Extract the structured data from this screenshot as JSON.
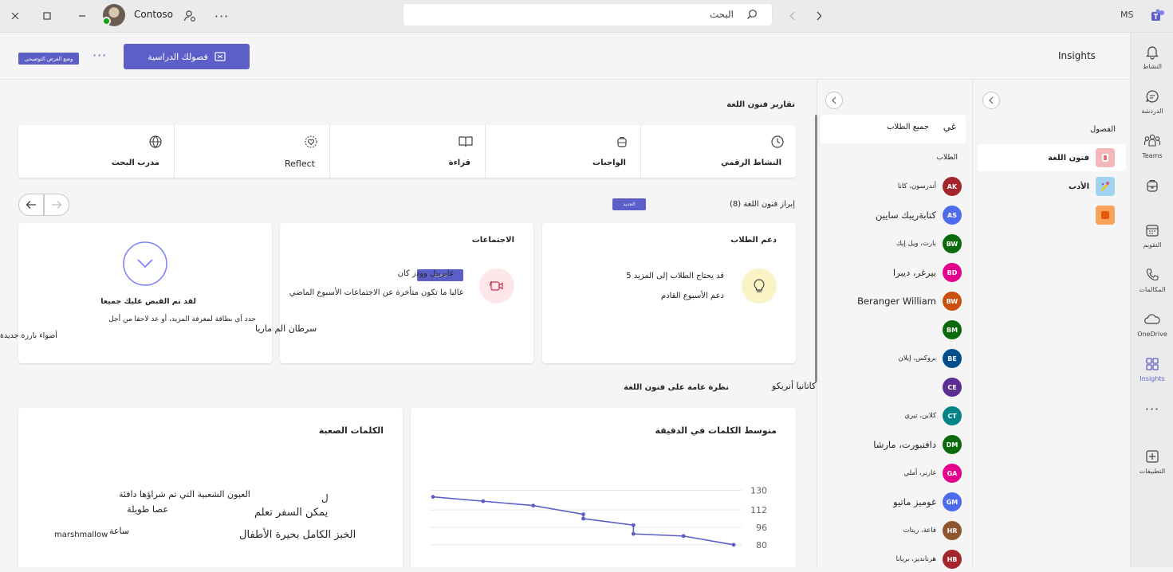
{
  "titlebar": {
    "org": "Contoso",
    "search_text": "البحث",
    "user_initials": "MS"
  },
  "rail": [
    {
      "label": "النشاط",
      "icon": "bell-icon"
    },
    {
      "label": "الدردشة",
      "icon": "chat-icon"
    },
    {
      "label": "Teams",
      "icon": "teams-icon"
    },
    {
      "label": "",
      "icon": "backpack-icon"
    },
    {
      "label": "التقويم",
      "icon": "calendar-icon"
    },
    {
      "label": "المكالمات",
      "icon": "phone-icon"
    },
    {
      "label": "OneDrive",
      "icon": "cloud-icon"
    },
    {
      "label": "Insights",
      "icon": "insights-icon"
    },
    {
      "label": "",
      "icon": "more-icon"
    },
    {
      "label": "التطبيقات",
      "icon": "add-apps-icon"
    }
  ],
  "topstrip": {
    "app_title": "Insights",
    "classes_button": "فصولك الدراسية",
    "present_mode": "وضع العرض التوضيحي"
  },
  "classes": {
    "heading": "الفصول",
    "items": [
      {
        "name": "فنون اللغة",
        "color": "#f4b8b8"
      },
      {
        "name": "الأدب",
        "color": "#9fd3f0"
      },
      {
        "name": "",
        "color": "#f7a35c"
      }
    ]
  },
  "students": {
    "all_label": "جميع الطلاب",
    "all_prefix": "غي",
    "heading": "الطلاب",
    "items": [
      {
        "initials": "AK",
        "name": "أندرسون، كانا",
        "color": "#a4262c",
        "big": false
      },
      {
        "initials": "AS",
        "name": "كتابةريبك سايين",
        "color": "#4f6bed",
        "big": true
      },
      {
        "initials": "BW",
        "name": "بارت، ويل إيك",
        "color": "#0b6a0b",
        "big": false
      },
      {
        "initials": "BD",
        "name": "بيرغر، ديبرا",
        "color": "#e3008c",
        "big": true
      },
      {
        "initials": "BW",
        "name": "Beranger William",
        "color": "#ca5010",
        "big": true
      },
      {
        "initials": "BM",
        "name": "",
        "color": "#0b6a0b",
        "big": false
      },
      {
        "initials": "BE",
        "name": "بروكس، إيلان",
        "color": "#004e8c",
        "big": false
      },
      {
        "initials": "CE",
        "name": "",
        "color": "#5c2e91",
        "big": false
      },
      {
        "initials": "CT",
        "name": "كلاين، تيري",
        "color": "#038387",
        "big": false
      },
      {
        "initials": "DM",
        "name": "دافنبورت، مارشا",
        "color": "#0b6a0b",
        "big": true
      },
      {
        "initials": "GA",
        "name": "غارنر، أملي",
        "color": "#e3008c",
        "big": false
      },
      {
        "initials": "GM",
        "name": "غوميز ماتيو",
        "color": "#4f6bed",
        "big": true
      },
      {
        "initials": "HR",
        "name": "قاعة، ريتات",
        "color": "#8e562e",
        "big": false
      },
      {
        "initials": "HB",
        "name": "هرنانديز، بريانا",
        "color": "#a4262c",
        "big": false
      }
    ]
  },
  "reports": {
    "title": "تقارير فنون اللغة",
    "tabs": [
      {
        "label": "النشاط الرقمي",
        "icon": "clock-icon"
      },
      {
        "label": "الواجبات",
        "icon": "assignment-icon"
      },
      {
        "label": "قراءة",
        "icon": "book-icon"
      },
      {
        "label": "Reflect",
        "icon": "reflect-icon"
      },
      {
        "label": "مدرب البحث",
        "icon": "globe-icon"
      }
    ]
  },
  "highlights": {
    "title": "إبراز فنون اللغة (8)",
    "new_badge": "الجديد",
    "card1": {
      "title": "دعم الطلاب",
      "line1": "5 قد يحتاج الطلاب إلى المزيد",
      "line2": "دعم الأسبوع القادم"
    },
    "card2": {
      "title": "الاجتماعات",
      "line1": "غابرييل وودز كان",
      "line2": "غالبا ما تكون متأخرة عن الاجتماعات الأسبوع الماضي",
      "badge": "تحديث"
    },
    "card3": {
      "line1": "لقد تم القبض عليك جميعا",
      "line2": "حدد أي بطاقة لمعرفة المزيد، أو عد لاحقا من أجل",
      "overflow1": "سرطان الم ماريا",
      "overflow2": "أضواء بارزة جديدة"
    }
  },
  "overview": {
    "title": "نظرة عامة على فنون اللغة",
    "overflow_name": "كاتانيا أنريكو"
  },
  "wpm": {
    "title": "متوسط الكلمات في الدقيقة"
  },
  "hard_words": {
    "title": "الكلمات الصعبة",
    "words": [
      "ل",
      "العيون الشعبية التي تم شراؤها دافئة",
      "عصا طويلة",
      "يمكن السفر تعلم",
      "ساعة",
      "marshmallow",
      "الخبز الكامل بحيرة الأطفال"
    ]
  },
  "chart_data": {
    "type": "line",
    "title": "متوسط الكلمات في الدقيقة",
    "y_ticks": [
      130,
      112,
      96,
      80
    ],
    "ylim": [
      74,
      134
    ],
    "x": [
      1,
      2,
      3,
      4,
      4,
      5,
      5,
      6,
      7
    ],
    "values": [
      124,
      120,
      116,
      108,
      104,
      98,
      90,
      88,
      80
    ],
    "color": "#5b5fc7"
  }
}
